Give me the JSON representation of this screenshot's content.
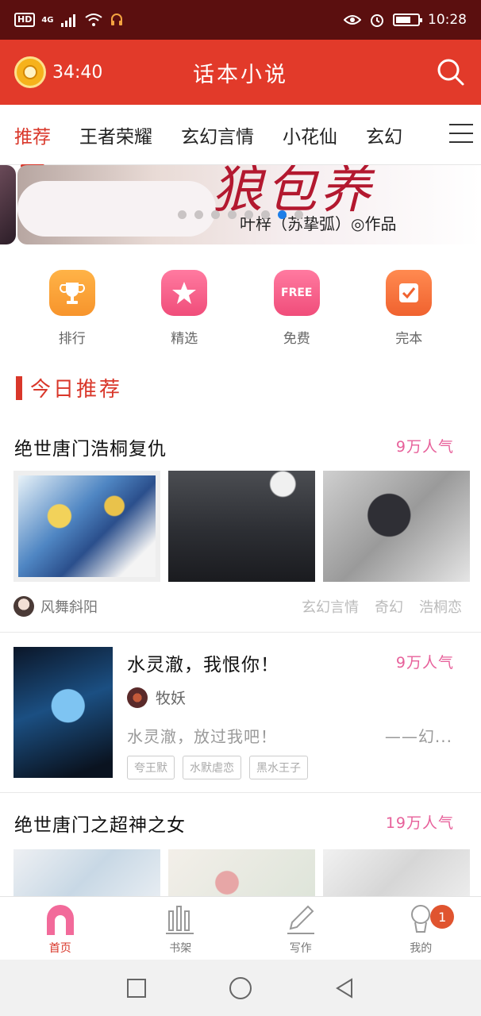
{
  "status_bar": {
    "network_badge": "HD",
    "network_type": "4G",
    "time": "10:28",
    "battery_level_percent": 60
  },
  "header": {
    "timer": "34:40",
    "title": "话本小说",
    "accent_color": "#e23a2a"
  },
  "tabs": [
    "推荐",
    "王者荣耀",
    "玄幻言情",
    "小花仙",
    "玄幻"
  ],
  "active_tab": "推荐",
  "banner": {
    "headline": "狼包养",
    "byline": "叶梓（苏挚弧）◎作品",
    "dot_count": 8,
    "active_dot_index": 6
  },
  "quick_entries": [
    {
      "label": "排行",
      "icon": "trophy-icon",
      "color": "#f7942c"
    },
    {
      "label": "精选",
      "icon": "star-icon",
      "color": "#f04d7a"
    },
    {
      "label": "免费",
      "icon": "free-tag-icon",
      "badge_text": "FREE",
      "color": "#f04d7a"
    },
    {
      "label": "完本",
      "icon": "checkmark-note-icon",
      "color": "#f0622f"
    }
  ],
  "section": {
    "title": "今日推荐"
  },
  "cards": [
    {
      "title": "绝世唐门浩桐复仇",
      "popularity": "9万人气",
      "author": "风舞斜阳",
      "tags": [
        "玄幻言情",
        "奇幻",
        "浩桐恋"
      ]
    },
    {
      "title": "水灵澈，我恨你！",
      "popularity": "9万人气",
      "author": "牧妖",
      "excerpt": "水灵澈，放过我吧！",
      "excerpt_tail": "——幻...",
      "tags": [
        "夸王默",
        "水默虐恋",
        "黑水王子"
      ]
    },
    {
      "title": "绝世唐门之超神之女",
      "popularity": "19万人气"
    }
  ],
  "bottom_nav": [
    {
      "label": "首页",
      "icon": "home-icon",
      "active": true
    },
    {
      "label": "书架",
      "icon": "bookshelf-icon",
      "active": false
    },
    {
      "label": "写作",
      "icon": "pencil-icon",
      "active": false
    },
    {
      "label": "我的",
      "icon": "profile-icon",
      "active": false,
      "badge": "1"
    }
  ]
}
